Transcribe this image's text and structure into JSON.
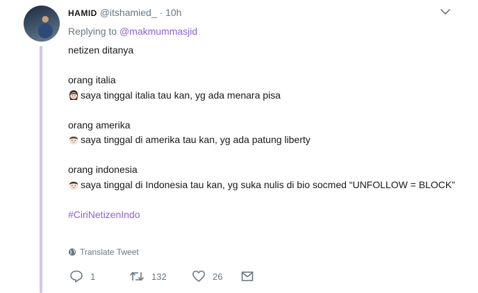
{
  "tweet": {
    "author_name": "HAMID",
    "author_handle": "@itshamied_",
    "separator": "·",
    "time": "10h",
    "replying_prefix": "Replying to",
    "replying_to": "@makmummasjid",
    "body": {
      "intro": "netizen ditanya",
      "italia_label": "orang italia",
      "italia_text": "saya tinggal italia tau kan, yg ada menara pisa",
      "amerika_label": "orang amerika",
      "amerika_text": "saya tinggal di amerika tau kan, yg ada patung liberty",
      "indonesia_label": "orang indonesia",
      "indonesia_text": "saya tinggal di Indonesia tau kan, yg suka nulis di bio socmed “UNFOLLOW = BLOCK”",
      "hashtag": "#CiriNetizenIndo"
    },
    "translate_label": "Translate Tweet",
    "replies": "1",
    "retweets": "132",
    "likes": "26"
  },
  "icons": {
    "menu": "chevron-down-icon",
    "translate": "globe-icon",
    "reply": "reply-icon",
    "retweet": "retweet-icon",
    "like": "heart-icon",
    "message": "envelope-icon",
    "emoji_italia": "woman-face-emoji",
    "emoji_amerika": "man-face-emoji",
    "emoji_indonesia": "man-face-emoji"
  },
  "colors": {
    "accent": "#8c63c7",
    "muted": "#657786",
    "thread": "#d2c6e8"
  }
}
